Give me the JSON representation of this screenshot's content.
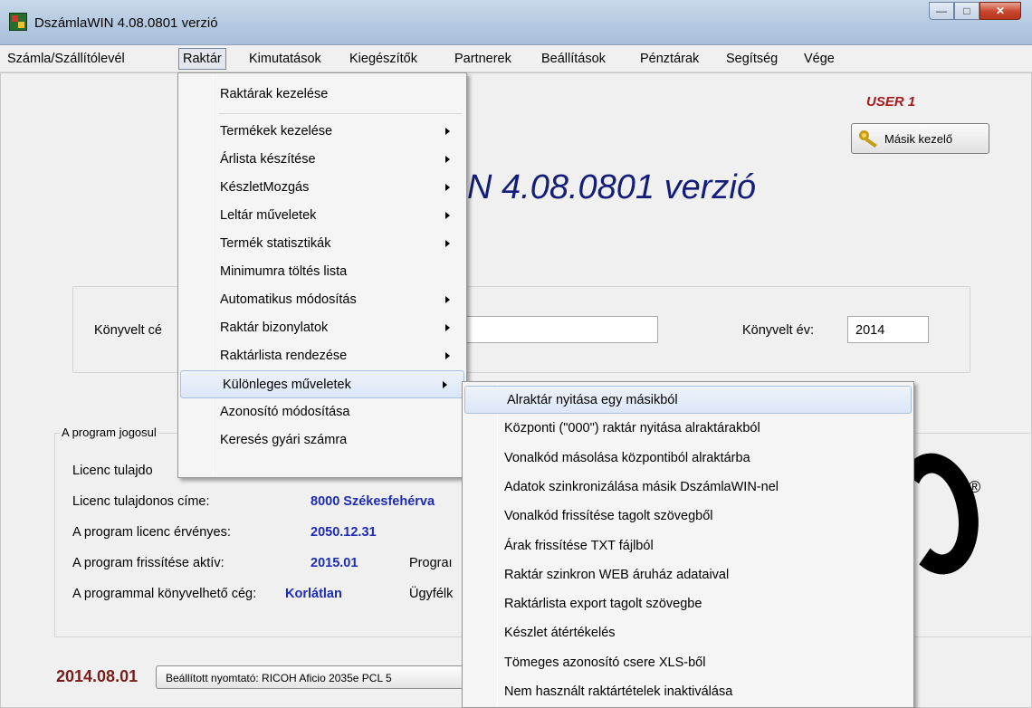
{
  "window": {
    "title": "DszámlaWIN 4.08.0801 verzió"
  },
  "menubar": {
    "items": [
      "Számla/Szállítólevél",
      "Raktár",
      "Kimutatások",
      "Kiegészítők",
      "Partnerek",
      "Beállítások",
      "Pénztárak",
      "Segítség",
      "Vége"
    ],
    "active": "Raktár"
  },
  "header": {
    "user": "USER 1",
    "other_user_button": "Másik kezelő",
    "big_title": "N 4.08.0801 verzió"
  },
  "company": {
    "label": "Könyvelt cé",
    "year_label": "Könyvelt év:",
    "year_value": "2014"
  },
  "license": {
    "legend": "A program jogosul",
    "rows": [
      {
        "label": "Licenc tulajdo",
        "value": "",
        "extra": ""
      },
      {
        "label": "Licenc tulajdonos címe:",
        "value": "8000 Székesfehérva",
        "extra": ""
      },
      {
        "label": "A program licenc érvényes:",
        "value": "2050.12.31",
        "extra": ""
      },
      {
        "label": "A program frissítése aktív:",
        "value": "2015.01",
        "extra": "Prograı"
      },
      {
        "label": "A programmal könyvelhető cég:",
        "value": "Korlátlan",
        "extra": "Ügyfélk"
      }
    ]
  },
  "status": {
    "date": "2014.08.01",
    "printer": "Beállított nyomtató: RICOH Aficio 2035e PCL 5"
  },
  "raktar_menu": {
    "items": [
      {
        "label": "Raktárak kezelése",
        "submenu": false
      },
      {
        "label": "Termékek kezelése",
        "submenu": true
      },
      {
        "label": "Árlista készítése",
        "submenu": true
      },
      {
        "label": "KészletMozgás",
        "submenu": true
      },
      {
        "label": "Leltár műveletek",
        "submenu": true
      },
      {
        "label": "Termék statisztikák",
        "submenu": true
      },
      {
        "label": "Minimumra töltés lista",
        "submenu": false
      },
      {
        "label": "Automatikus módosítás",
        "submenu": true
      },
      {
        "label": "Raktár bizonylatok",
        "submenu": true
      },
      {
        "label": "Raktárlista rendezése",
        "submenu": true
      },
      {
        "label": "Különleges műveletek",
        "submenu": true
      },
      {
        "label": "Azonosító módosítása",
        "submenu": false
      },
      {
        "label": "Keresés gyári számra",
        "submenu": false
      }
    ],
    "highlighted": "Különleges műveletek"
  },
  "special_menu": {
    "items": [
      "Alraktár nyitása egy másikból",
      "Központi (\"000\") raktár nyitása alraktárakból",
      "Vonalkód másolása központiból alraktárba",
      "Adatok szinkronizálása másik DszámlaWIN-nel",
      "Vonalkód frissítése tagolt szövegből",
      "Árak frissítése TXT fájlból",
      "Raktár szinkron WEB áruház adataival",
      "Raktárlista export tagolt szövegbe",
      "Készlet átértékelés",
      "Tömeges azonosító csere XLS-ből",
      "Nem használt raktártételek inaktiválása"
    ],
    "highlighted": "Alraktár nyitása egy másikból"
  }
}
